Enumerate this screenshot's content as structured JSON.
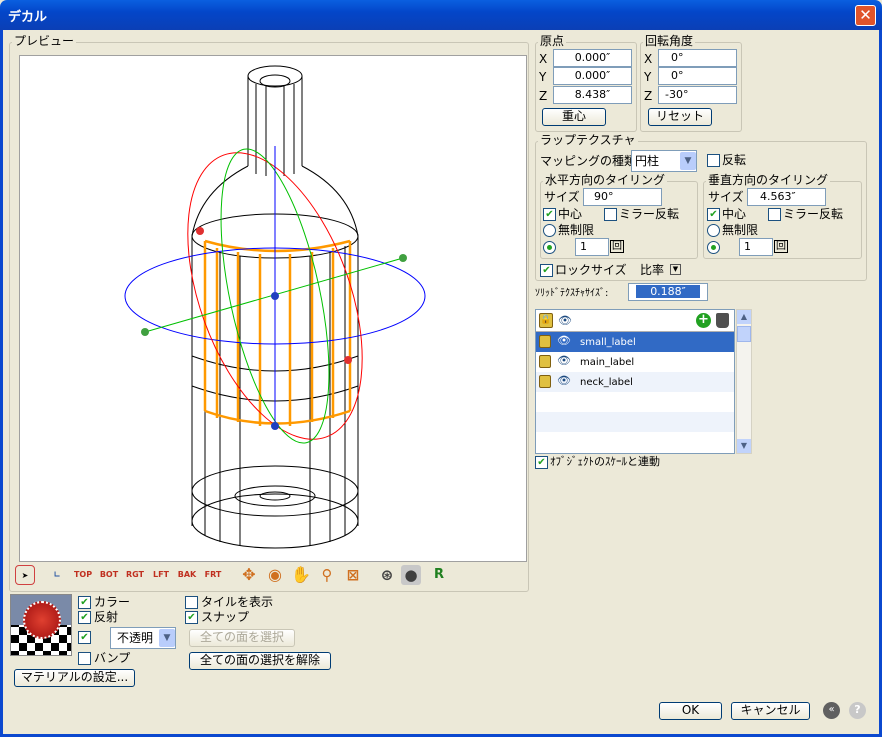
{
  "window": {
    "title": "デカル",
    "close": "✕"
  },
  "preview": {
    "label": "プレビュー"
  },
  "origin": {
    "label": "原点",
    "x_label": "X",
    "y_label": "Y",
    "z_label": "Z",
    "x": "0.000″",
    "y": "0.000″",
    "z": "8.438″",
    "center_button": "重心"
  },
  "rotation": {
    "label": "回転角度",
    "x_label": "X",
    "y_label": "Y",
    "z_label": "Z",
    "x": "0°",
    "y": "0°",
    "z": "-30°",
    "reset_button": "リセット"
  },
  "wrap": {
    "label": "ラップテクスチャ",
    "mapping_label": "マッピングの種類:",
    "mapping_value": "円柱",
    "flip_label": "反転",
    "flip_checked": false,
    "horizontal": {
      "label": "水平方向のタイリング",
      "size_label": "サイズ",
      "size": "90°",
      "center_label": "中心",
      "center_checked": true,
      "mirror_label": "ミラー反転",
      "mirror_checked": false,
      "unlimited_label": "無制限",
      "count": "1",
      "count_unit": "回"
    },
    "vertical": {
      "label": "垂直方向のタイリング",
      "size_label": "サイズ",
      "size": "4.563″",
      "center_label": "中心",
      "center_checked": true,
      "mirror_label": "ミラー反転",
      "mirror_checked": false,
      "unlimited_label": "無制限",
      "count": "1",
      "count_unit": "回"
    },
    "lock_size_label": "ロックサイズ",
    "lock_size_checked": true,
    "ratio_label": "比率",
    "solid_size_label": "ｿﾘｯﾄﾞﾃｸｽﾁｬｻｲｽﾞ:",
    "solid_size": "0.188″"
  },
  "layers": {
    "items": [
      {
        "label": "small_label",
        "selected": true
      },
      {
        "label": "main_label",
        "selected": false
      },
      {
        "label": "neck_label",
        "selected": false
      }
    ],
    "scale_link_label": "ｵﾌﾞｼﾞｪｸﾄのｽｹｰﾙと連動",
    "scale_link_checked": true
  },
  "toolbar": {
    "top": "TOP",
    "bot": "BOT",
    "rgt": "RGT",
    "lft": "LFT",
    "bak": "BAK",
    "frt": "FRT"
  },
  "material": {
    "color_label": "カラー",
    "reflect_label": "反射",
    "opacity_value": "不透明",
    "bump_label": "バンプ",
    "settings_button": "マテリアルの設定..."
  },
  "options": {
    "show_tile_label": "タイルを表示",
    "snap_label": "スナップ",
    "select_all_button": "全ての面を選択",
    "deselect_all_button": "全ての面の選択を解除"
  },
  "footer": {
    "ok": "OK",
    "cancel": "キャンセル",
    "help": "?"
  },
  "colors": {
    "selected": "#316ac5",
    "accent": "#0b48cf"
  }
}
